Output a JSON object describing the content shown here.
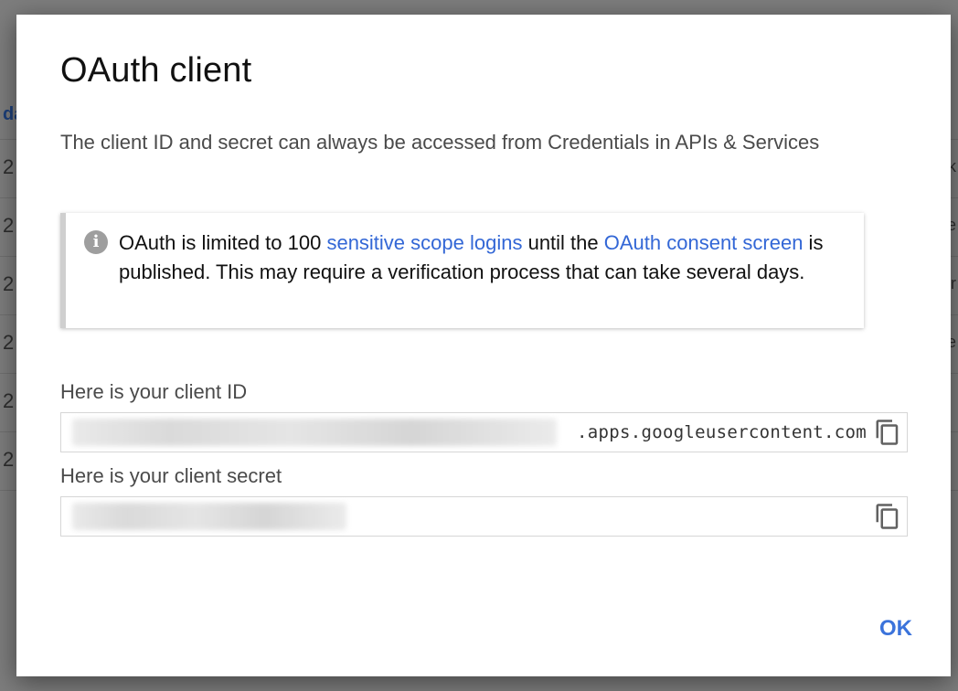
{
  "background": {
    "column_header": "da",
    "row_values": [
      "2",
      "2",
      "2",
      "2",
      "2",
      "2"
    ],
    "right_edge_glyphs": [
      "k",
      "e",
      "r",
      "e"
    ]
  },
  "dialog": {
    "title": "OAuth client",
    "description": "The client ID and secret can always be accessed from Credentials in APIs & Services",
    "notice": {
      "icon": "info-icon",
      "text_before": "OAuth is limited to 100 ",
      "link1": "sensitive scope logins",
      "text_middle": " until the ",
      "link2": "OAuth consent screen",
      "text_after": " is published. This may require a verification process that can take several days."
    },
    "client_id": {
      "label": "Here is your client ID",
      "visible_suffix": ".apps.googleusercontent.com",
      "copy_icon": "copy-icon"
    },
    "client_secret": {
      "label": "Here is your client secret",
      "copy_icon": "copy-icon"
    },
    "ok_label": "OK"
  },
  "colors": {
    "link": "#3367d6",
    "ok_button": "#3b73db",
    "notice_border": "#cfcfcf",
    "overlay": "#7d7d7d"
  }
}
